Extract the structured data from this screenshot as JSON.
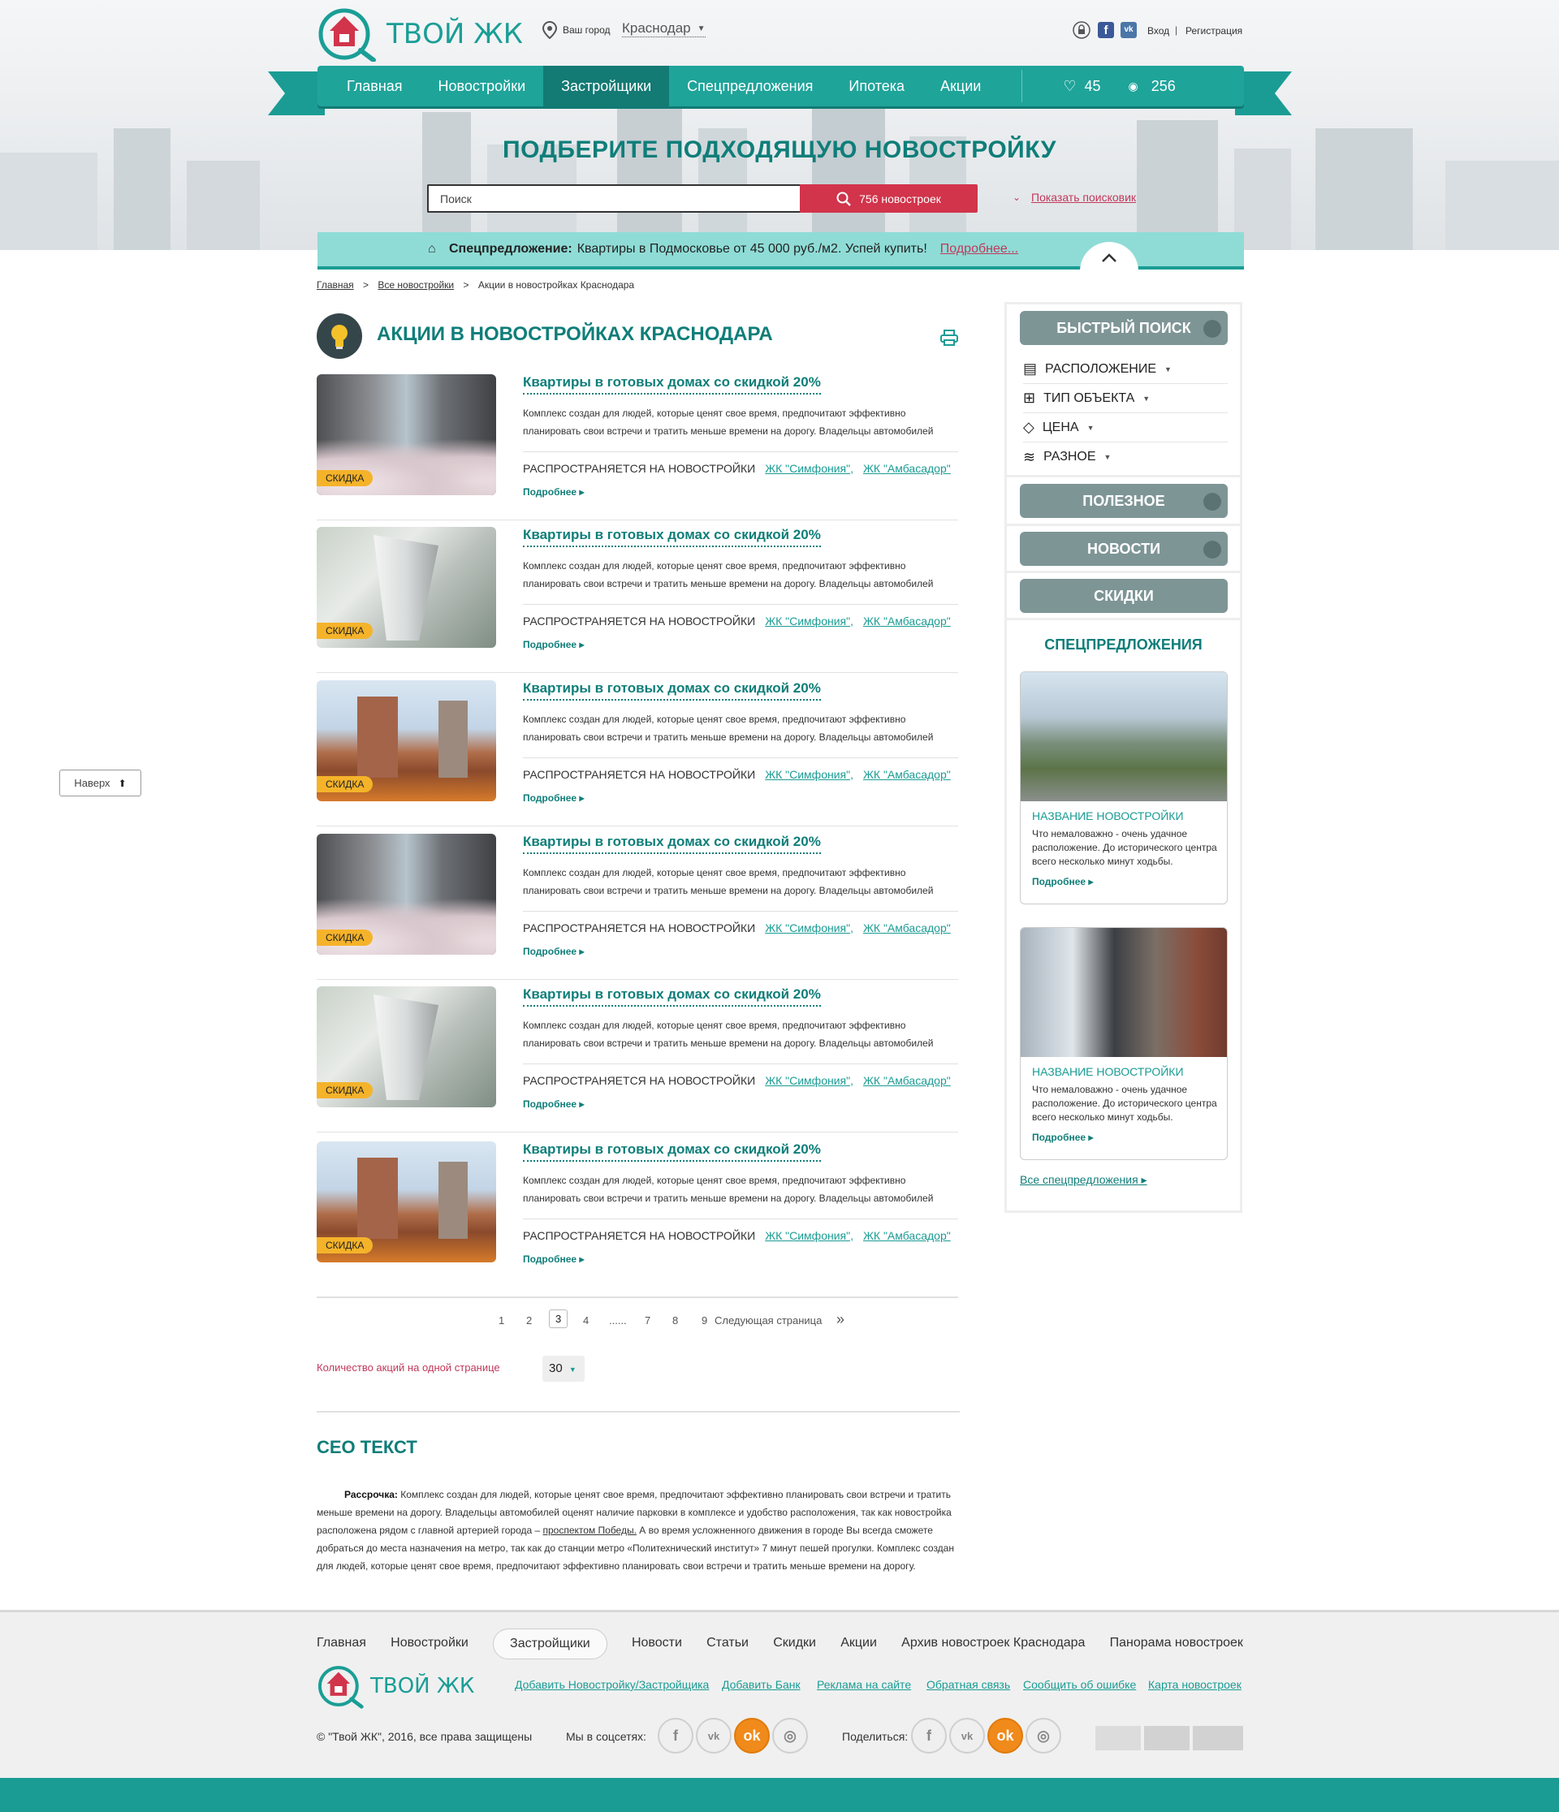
{
  "header": {
    "logo_text": "ТВОЙ ЖК",
    "city_label": "Ваш город",
    "city_value": "Краснодар",
    "login": "Вход",
    "divider": "|",
    "register": "Регистрация"
  },
  "nav": {
    "items": [
      "Главная",
      "Новостройки",
      "Застройщики",
      "Спецпредложения",
      "Ипотека",
      "Акции"
    ],
    "active_index": 2,
    "favorites_count": "45",
    "views_count": "256"
  },
  "hero": {
    "title": "ПОДБЕРИТЕ ПОДХОДЯЩУЮ НОВОСТРОЙКУ",
    "search_placeholder": "Поиск",
    "search_button": "756 новостроек",
    "show_search": "Показать поисковик"
  },
  "promo": {
    "label": "Спецпредложение:",
    "text": "Квартиры в Подмосковье от 45 000 руб./м2. Успей купить!",
    "more": "Подробнее..."
  },
  "breadcrumbs": {
    "home": "Главная",
    "all": "Все новостройки",
    "current": "Акции в новостройках Краснодара",
    "sep": ">"
  },
  "main": {
    "title": "АКЦИИ В НОВОСТРОЙКАХ КРАСНОДАРА",
    "items": [
      {
        "tag": "СКИДКА",
        "title": "Квартиры в готовых домах со скидкой 20%",
        "desc": "Комплекс создан для людей, которые ценят свое время, предпочитают эффективно планировать свои встречи и тратить меньше времени на дорогу. Владельцы автомобилей",
        "applies": "РАСПРОСТРАНЯЕТСЯ НА НОВОСТРОЙКИ",
        "link1": "ЖК \"Симфония\",",
        "link2": "ЖК \"Амбасадор\"",
        "more": "Подробнее"
      },
      {
        "tag": "СКИДКА",
        "title": "Квартиры в готовых домах со скидкой 20%",
        "desc": "Комплекс создан для людей, которые ценят свое время, предпочитают эффективно планировать свои встречи и тратить меньше времени на дорогу. Владельцы автомобилей",
        "applies": "РАСПРОСТРАНЯЕТСЯ НА НОВОСТРОЙКИ",
        "link1": "ЖК \"Симфония\",",
        "link2": "ЖК \"Амбасадор\"",
        "more": "Подробнее"
      },
      {
        "tag": "СКИДКА",
        "title": "Квартиры в готовых домах со скидкой 20%",
        "desc": "Комплекс создан для людей, которые ценят свое время, предпочитают эффективно планировать свои встречи и тратить меньше времени на дорогу. Владельцы автомобилей",
        "applies": "РАСПРОСТРАНЯЕТСЯ НА НОВОСТРОЙКИ",
        "link1": "ЖК \"Симфония\",",
        "link2": "ЖК \"Амбасадор\"",
        "more": "Подробнее"
      },
      {
        "tag": "СКИДКА",
        "title": "Квартиры в готовых домах со скидкой 20%",
        "desc": "Комплекс создан для людей, которые ценят свое время, предпочитают эффективно планировать свои встречи и тратить меньше времени на дорогу. Владельцы автомобилей",
        "applies": "РАСПРОСТРАНЯЕТСЯ НА НОВОСТРОЙКИ",
        "link1": "ЖК \"Симфония\",",
        "link2": "ЖК \"Амбасадор\"",
        "more": "Подробнее"
      },
      {
        "tag": "СКИДКА",
        "title": "Квартиры в готовых домах со скидкой 20%",
        "desc": "Комплекс создан для людей, которые ценят свое время, предпочитают эффективно планировать свои встречи и тратить меньше времени на дорогу. Владельцы автомобилей",
        "applies": "РАСПРОСТРАНЯЕТСЯ НА НОВОСТРОЙКИ",
        "link1": "ЖК \"Симфония\",",
        "link2": "ЖК \"Амбасадор\"",
        "more": "Подробнее"
      },
      {
        "tag": "СКИДКА",
        "title": "Квартиры в готовых домах со скидкой 20%",
        "desc": "Комплекс создан для людей, которые ценят свое время, предпочитают эффективно планировать свои встречи и тратить меньше времени на дорогу. Владельцы автомобилей",
        "applies": "РАСПРОСТРАНЯЕТСЯ НА НОВОСТРОЙКИ",
        "link1": "ЖК \"Симфония\",",
        "link2": "ЖК \"Амбасадор\"",
        "more": "Подробнее"
      }
    ]
  },
  "pagination": {
    "pages": [
      "1",
      "2",
      "3",
      "4",
      "......",
      "7",
      "8",
      "9"
    ],
    "current": "3",
    "next": "Следующая страница",
    "next_arrow": "»"
  },
  "per_page": {
    "label": "Количество акций на одной странице",
    "value": "30"
  },
  "seo": {
    "title": "СЕО ТЕКСТ",
    "lead": "Рассрочка:",
    "text1": " Комплекс создан для людей, которые ценят свое время, предпочитают эффективно планировать свои встречи и тратить меньше времени на дорогу. Владельцы автомобилей оценят наличие парковки в комплексе и удобство расположения, так как новостройка расположена рядом с главной артерией города – ",
    "link": "проспектом Победы.",
    "text2": " А во время усложненного движения в городе Вы всегда сможете добраться до места назначения на метро, так как до станции метро «Политехнический институт» 7 минут пешей прогулки. Комплекс создан для людей, которые ценят свое время, предпочитают эффективно планировать свои встречи и тратить меньше времени на дорогу."
  },
  "sidebar": {
    "quick_search": "БЫСТРЫЙ ПОИСК",
    "filters": [
      "РАСПОЛОЖЕНИЕ",
      "ТИП ОБЪЕКТА",
      "ЦЕНА",
      "РАЗНОЕ"
    ],
    "useful": "ПОЛЕЗНОЕ",
    "news": "НОВОСТИ",
    "discounts": "СКИДКИ",
    "offers_title": "СПЕЦПРЕДЛОЖЕНИЯ",
    "offers": [
      {
        "title": "НАЗВАНИЕ НОВОСТРОЙКИ",
        "desc": "Что немаловажно - очень удачное расположение. До исторического центра всего несколько минут ходьбы.",
        "more": "Подробнее"
      },
      {
        "title": "НАЗВАНИЕ НОВОСТРОЙКИ",
        "desc": "Что немаловажно - очень удачное расположение. До исторического центра всего несколько минут ходьбы.",
        "more": "Подробнее"
      }
    ],
    "all_offers": "Все спецпредложения"
  },
  "back_to_top": "Наверх",
  "footer": {
    "nav": [
      "Главная",
      "Новостройки",
      "Застройщики",
      "Новости",
      "Статьи",
      "Скидки",
      "Акции",
      "Архив новостроек Краснодара",
      "Панорама новостроек"
    ],
    "logo_text": "ТВОЙ ЖК",
    "links": [
      "Добавить Новостройку/Застройщика",
      "Добавить Банк",
      "Реклама на сайте",
      "Обратная связь",
      "Сообщить об ошибке",
      "Карта новостроек"
    ],
    "copyright": "© \"Твой ЖК\", 2016, все права защищены",
    "social_label": "Мы в соцсетях:",
    "share_label": "Поделиться:"
  },
  "colors": {
    "accent": "#1a9c94",
    "accent_dark": "#0f7e79",
    "search_button": "#d1344b",
    "tag": "#f5b32a",
    "sidebar_button": "#7e9596"
  }
}
